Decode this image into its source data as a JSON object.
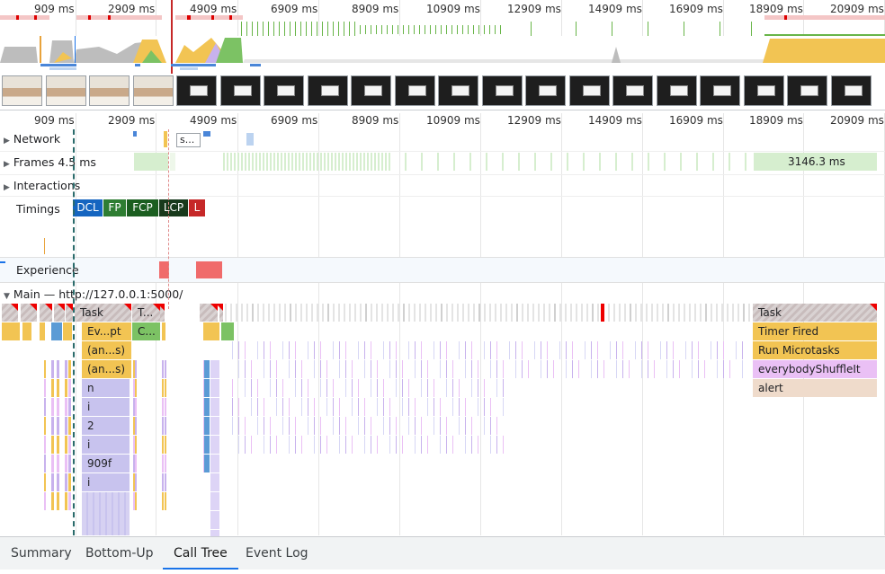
{
  "ruler_top": [
    "909 ms",
    "2909 ms",
    "4909 ms",
    "6909 ms",
    "8909 ms",
    "10909 ms",
    "12909 ms",
    "14909 ms",
    "16909 ms",
    "18909 ms",
    "20909 ms"
  ],
  "ruler_main": [
    "909 ms",
    "2909 ms",
    "4909 ms",
    "6909 ms",
    "8909 ms",
    "10909 ms",
    "12909 ms",
    "14909 ms",
    "16909 ms",
    "18909 ms",
    "20909 ms"
  ],
  "tracks": {
    "network": "Network",
    "network_item": "s...",
    "frames": "Frames",
    "frames_value": "4.5 ms",
    "frames_long": "3146.3 ms",
    "interactions": "Interactions",
    "timings": "Timings",
    "experience": "Experience",
    "main": "Main — http://127.0.0.1:5000/"
  },
  "timings_badges": [
    {
      "label": "DCL",
      "color": "#1565c0"
    },
    {
      "label": "FP",
      "color": "#2e7d32"
    },
    {
      "label": "FCP",
      "color": "#1b5e20"
    },
    {
      "label": "LCP",
      "color": "#183a1c"
    },
    {
      "label": "L",
      "color": "#c62828"
    }
  ],
  "flame_left": {
    "row0": [
      "Task",
      "T..."
    ],
    "row1": [
      "Ev...pt",
      "C..."
    ],
    "stack": [
      "(an...s)",
      "(an...s)",
      "n",
      "i",
      "2",
      "i",
      "909f",
      "i"
    ]
  },
  "flame_right": [
    "Task",
    "Timer Fired",
    "Run Microtasks",
    "everybodyShuffleIt",
    "alert"
  ],
  "colors": {
    "scripting": "#f2c453",
    "rendering": "#c8b2ed",
    "painting": "#7cc264",
    "user_function": "#eac0f5",
    "alert": "#efdbcb",
    "frame": "#d6eecf",
    "experience": "#f06b6b",
    "accent": "#1a73e8"
  },
  "bottom_tabs": [
    "Summary",
    "Bottom-Up",
    "Call Tree",
    "Event Log"
  ],
  "active_tab": "Call Tree"
}
